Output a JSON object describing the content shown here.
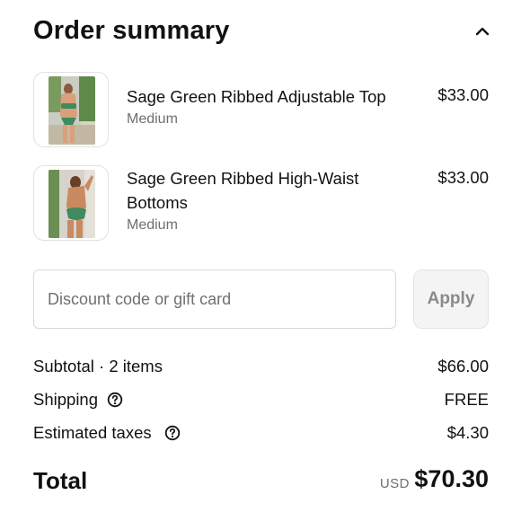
{
  "header": {
    "title": "Order summary",
    "toggle_icon": "chevron-up-icon"
  },
  "products": [
    {
      "name": "Sage Green Ribbed Adjustable Top",
      "variant": "Medium",
      "price": "$33.00",
      "image": "product-photo"
    },
    {
      "name": "Sage Green Ribbed High-Waist Bottoms",
      "variant": "Medium",
      "price": "$33.00",
      "image": "product-photo"
    }
  ],
  "discount": {
    "placeholder": "Discount code or gift card",
    "value": "",
    "apply_label": "Apply"
  },
  "summary": {
    "subtotal_label": "Subtotal · 2 items",
    "subtotal_value": "$66.00",
    "shipping_label": "Shipping",
    "shipping_value": "FREE",
    "taxes_label": "Estimated taxes",
    "taxes_value": "$4.30",
    "help_icon": "question-circle-icon"
  },
  "total": {
    "label": "Total",
    "currency": "USD",
    "value": "$70.30"
  },
  "colors": {
    "text": "#111111",
    "muted": "#6f6f6f",
    "border": "#d9d9d9",
    "button_bg": "#f4f4f4",
    "swimsuit_green": "#3f8a5e"
  }
}
